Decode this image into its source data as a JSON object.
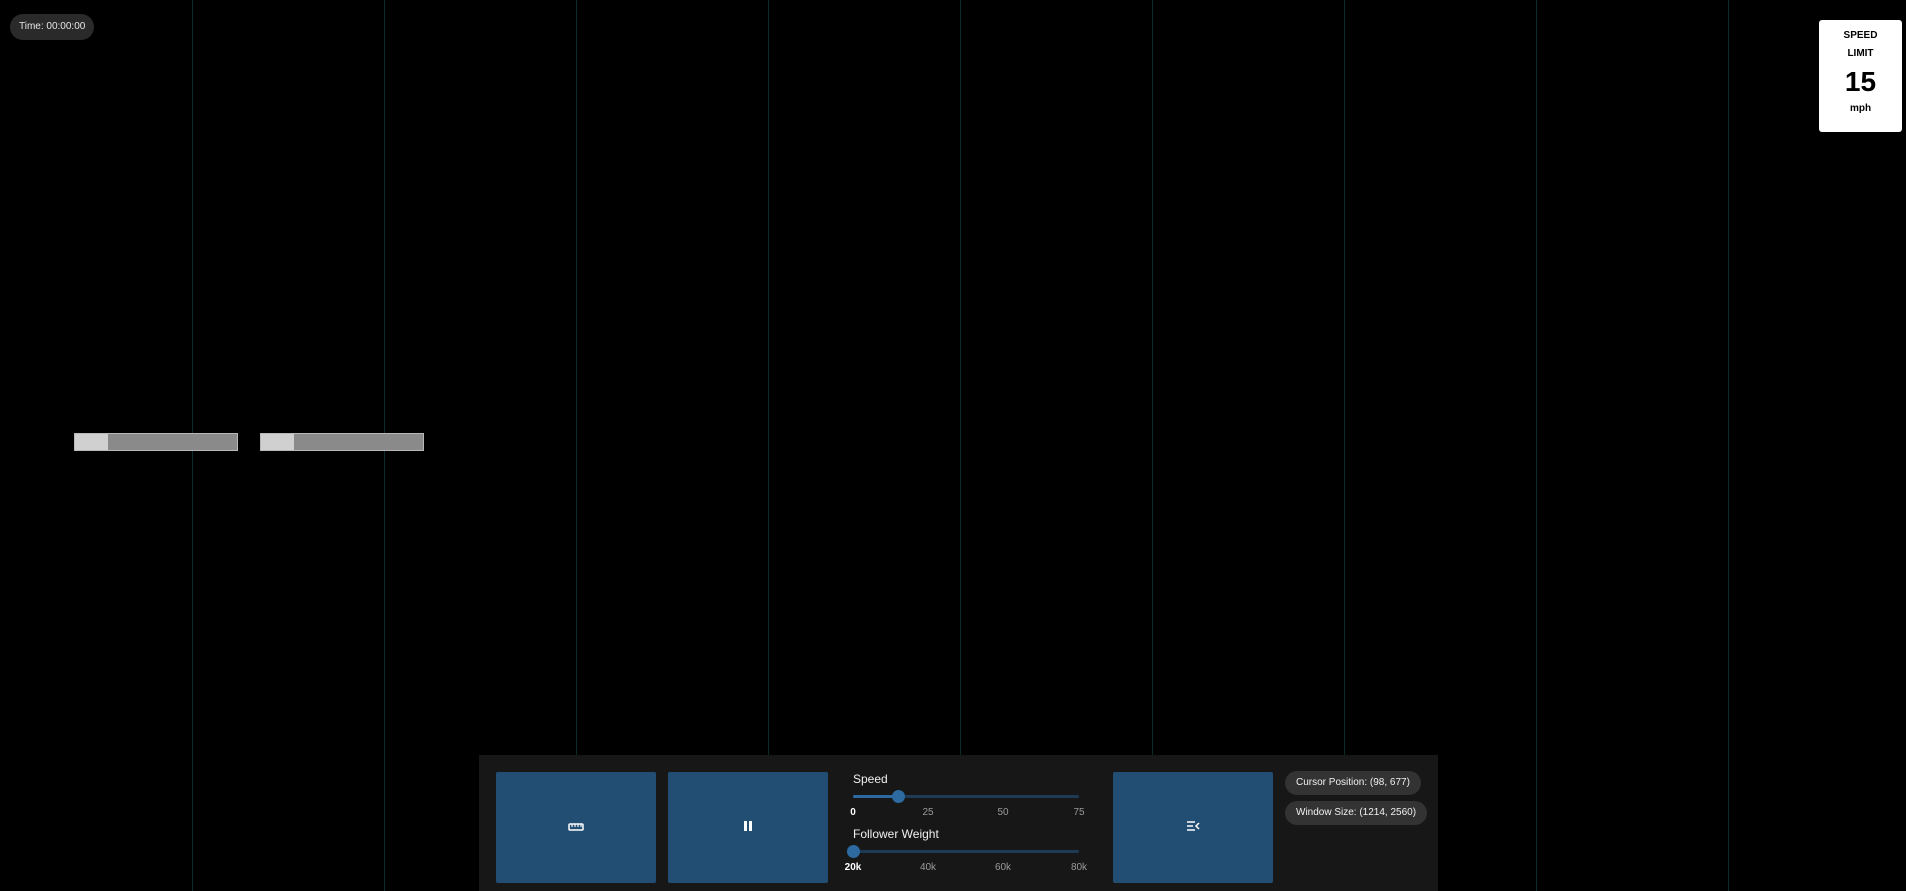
{
  "hud": {
    "time_label": "Time: 00:00:00"
  },
  "speed_sign": {
    "title": "SPEED LIMIT",
    "value": "15",
    "unit": "mph"
  },
  "controls": {
    "buttons": [
      {
        "name": "ruler-button",
        "icon": "ruler-icon"
      },
      {
        "name": "pause-button",
        "icon": "pause-icon"
      },
      {
        "name": "menu-collapse-button",
        "icon": "menu-collapse-icon"
      }
    ],
    "speed_slider": {
      "label": "Speed",
      "value": 15,
      "min": 0,
      "max": 75,
      "ticks": [
        "0",
        "25",
        "50",
        "75"
      ],
      "active_tick": "0"
    },
    "weight_slider": {
      "label": "Follower Weight",
      "value": 20,
      "min": 20,
      "max": 80,
      "ticks": [
        "20k",
        "40k",
        "60k",
        "80k"
      ],
      "active_tick": "20k"
    }
  },
  "status": {
    "cursor_position": "Cursor Position: (98, 677)",
    "window_size": "Window Size: (1214, 2560)"
  },
  "colors": {
    "background": "#000000",
    "gridline": "#0d2a2f",
    "button": "#234e73",
    "slider_accent": "#2d6aa0",
    "panel": "#171717"
  }
}
